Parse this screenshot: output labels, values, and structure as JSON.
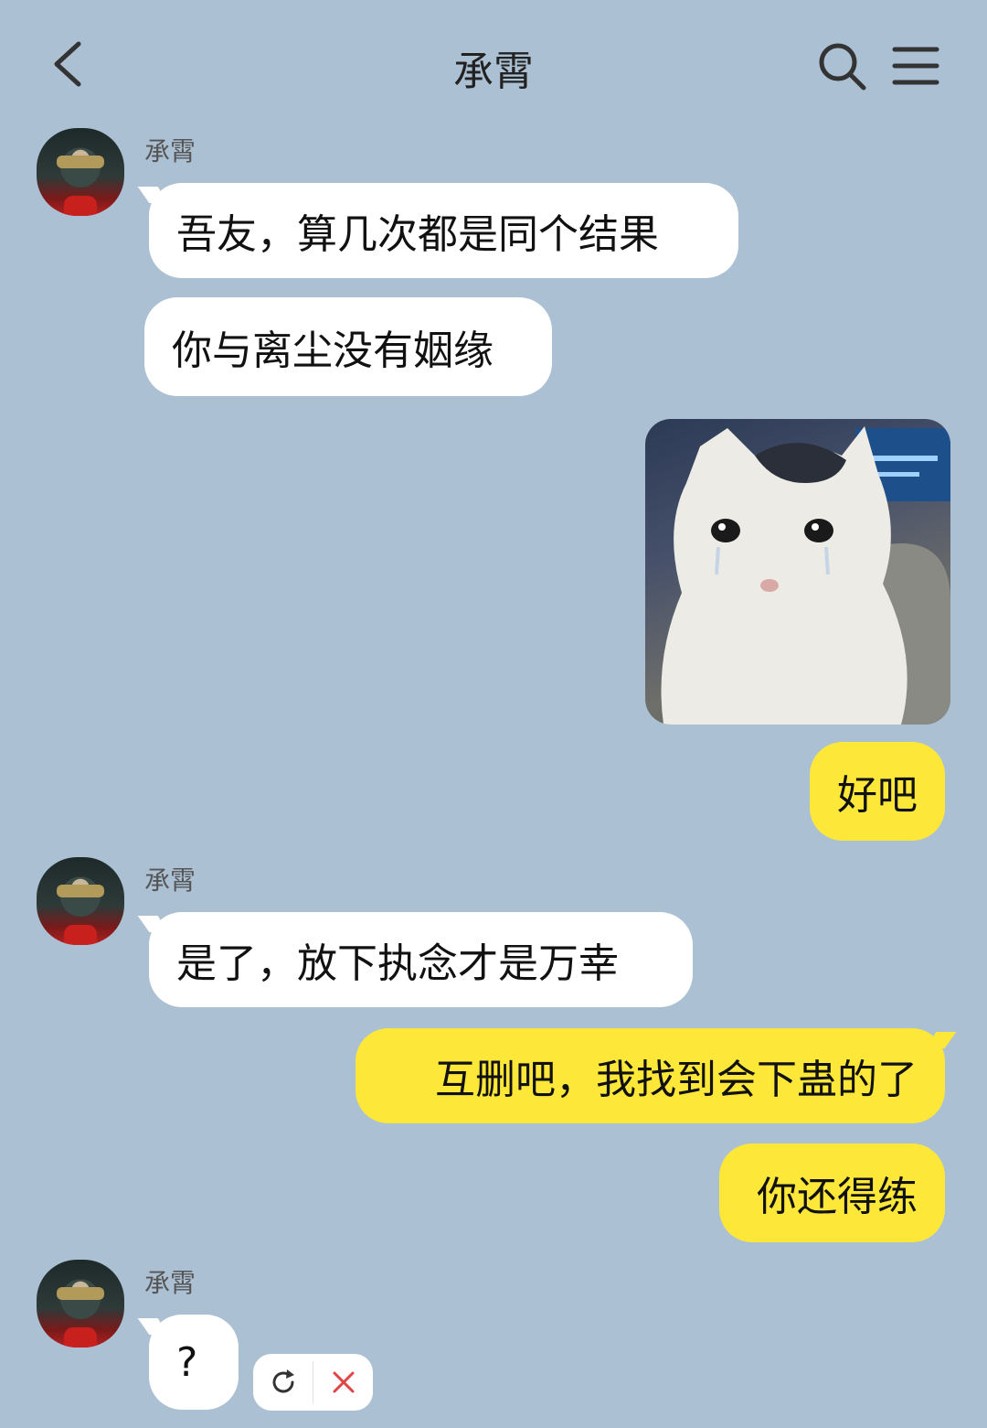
{
  "header": {
    "title": "承霄"
  },
  "messages": [
    {
      "sender": "承霄",
      "text": "吾友，算几次都是同个结果"
    },
    {
      "text": "你与离尘没有姻缘"
    },
    {
      "sticker": "crying-cat-sticker"
    },
    {
      "text": "好吧"
    },
    {
      "sender": "承霄",
      "text": "是了，放下执念才是万幸"
    },
    {
      "text": "互删吧，我找到会下蛊的了"
    },
    {
      "text": "你还得练"
    },
    {
      "sender": "承霄",
      "text": "?"
    }
  ],
  "actions": {
    "retry_icon": "retry-icon",
    "cancel_icon": "close-icon"
  },
  "colors": {
    "background": "#abc0d3",
    "incoming_bubble": "#ffffff",
    "outgoing_bubble": "#fde83a",
    "cancel": "#e04545"
  }
}
